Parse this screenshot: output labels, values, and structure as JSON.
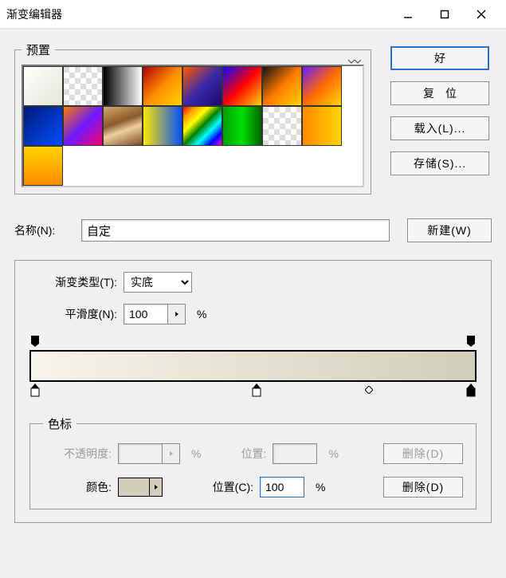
{
  "window": {
    "title": "渐变编辑器"
  },
  "presets": {
    "legend": "预置"
  },
  "buttons": {
    "ok": "好",
    "reset": "复位",
    "load": "载入(L)...",
    "save": "存储(S)...",
    "new": "新建(W)"
  },
  "name": {
    "label": "名称(N):",
    "value": "自定"
  },
  "grad": {
    "type_label": "渐变类型(T):",
    "type_value": "实底",
    "smooth_label": "平滑度(N):",
    "smooth_value": "100",
    "pct": "%"
  },
  "stops": {
    "legend": "色标",
    "opacity_label": "不透明度:",
    "loc_label": "位置:",
    "loc2_label": "位置(C):",
    "loc2_value": "100",
    "pct": "%",
    "color_label": "颜色:",
    "delete": "删除(D)"
  }
}
